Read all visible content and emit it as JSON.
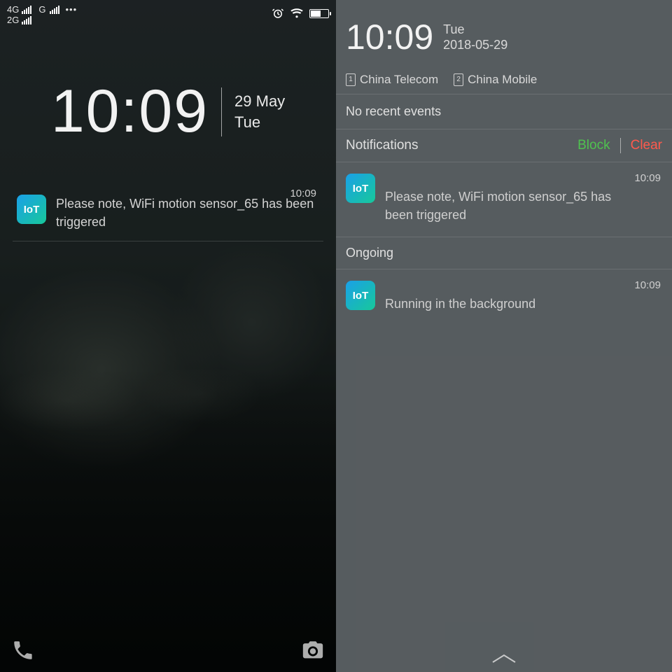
{
  "left": {
    "status": {
      "net1_label": "4G",
      "net2_label": "2G",
      "carrier_extra": "G",
      "more_dots": "•••"
    },
    "clock": {
      "time": "10:09",
      "date_line1": "29 May",
      "date_line2": "Tue"
    },
    "notification": {
      "app_icon_text": "IoT",
      "time": "10:09",
      "text": "Please note, WiFi motion sensor_65 has been triggered"
    }
  },
  "right": {
    "clock": {
      "time": "10:09",
      "day": "Tue",
      "date": "2018-05-29"
    },
    "sims": [
      {
        "slot": "1",
        "name": "China Telecom"
      },
      {
        "slot": "2",
        "name": "China Mobile"
      }
    ],
    "events_label": "No recent events",
    "notifications_header": "Notifications",
    "block_label": "Block",
    "clear_label": "Clear",
    "notif1": {
      "app_icon_text": "IoT",
      "time": "10:09",
      "text": "Please note, WiFi motion sensor_65 has been triggered"
    },
    "ongoing_header": "Ongoing",
    "notif2": {
      "app_icon_text": "IoT",
      "time": "10:09",
      "text": "Running in the background"
    }
  }
}
